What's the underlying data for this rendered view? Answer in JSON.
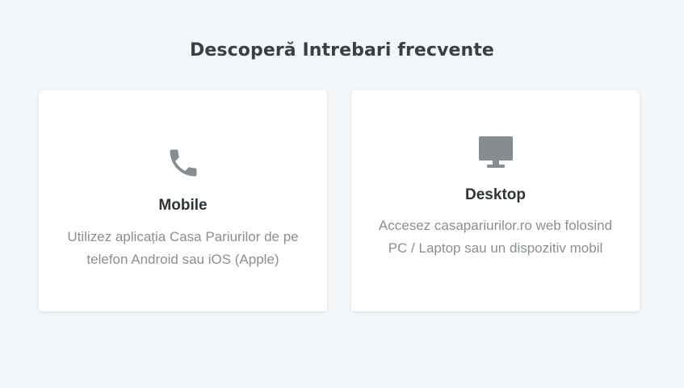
{
  "header": {
    "title": "Descoperă Intrebari frecvente"
  },
  "cards": [
    {
      "icon": "phone-icon",
      "title": "Mobile",
      "description": "Utilizez aplicația Casa Pariurilor de pe telefon Android sau iOS (Apple)"
    },
    {
      "icon": "desktop-monitor-icon",
      "title": "Desktop",
      "description": "Accesez casapariurilor.ro web folosind PC / Laptop sau un dispozitiv mobil"
    }
  ],
  "colors": {
    "background": "#f4f7fa",
    "card": "#ffffff",
    "icon": "#878c91",
    "title": "#2f3438",
    "text": "#8a8f94"
  }
}
